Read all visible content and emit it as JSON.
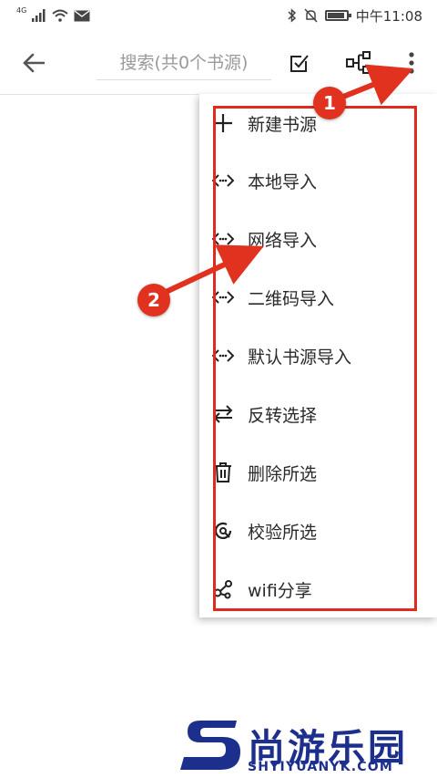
{
  "status_bar": {
    "network": "4G",
    "time": "中午11:08"
  },
  "toolbar": {
    "search_placeholder": "搜索(共0个书源)"
  },
  "menu": {
    "items": [
      {
        "label": "新建书源",
        "icon": "plus-icon"
      },
      {
        "label": "本地导入",
        "icon": "import-icon"
      },
      {
        "label": "网络导入",
        "icon": "import-icon"
      },
      {
        "label": "二维码导入",
        "icon": "import-icon"
      },
      {
        "label": "默认书源导入",
        "icon": "import-icon"
      },
      {
        "label": "反转选择",
        "icon": "swap-arrows-icon"
      },
      {
        "label": "删除所选",
        "icon": "trash-icon"
      },
      {
        "label": "校验所选",
        "icon": "check-search-icon"
      },
      {
        "label": "wifi分享",
        "icon": "share-icon"
      }
    ]
  },
  "annotations": {
    "badge_1": "1",
    "badge_2": "2",
    "accent_color": "#e0321f"
  },
  "watermark": {
    "text": "尚游乐园",
    "domain": "SHYIYUANYK.COM"
  }
}
